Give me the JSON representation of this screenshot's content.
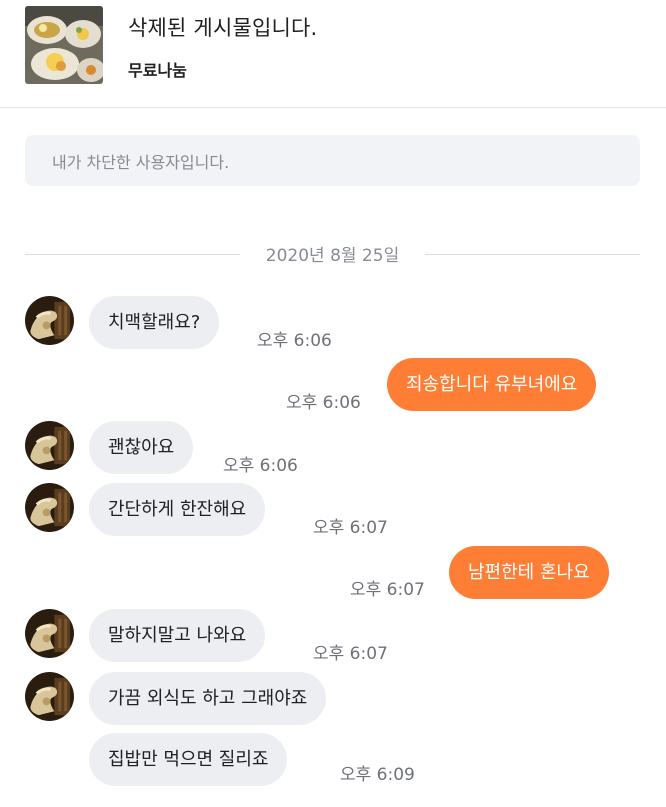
{
  "header": {
    "post_title": "삭제된 게시물입니다.",
    "post_status": "무료나눔"
  },
  "notice": {
    "text": "내가 차단한 사용자입니다."
  },
  "date_divider": "2020년 8월 25일",
  "messages": [
    {
      "text": "치맥할래요?",
      "time": "오후 6:06"
    },
    {
      "text": "죄송합니다 유부녀에요",
      "time": "오후 6:06"
    },
    {
      "text": "괜찮아요",
      "time": "오후 6:06"
    },
    {
      "text": "간단하게 한잔해요",
      "time": "오후 6:07"
    },
    {
      "text": "남편한테 혼나요",
      "time": "오후 6:07"
    },
    {
      "text": "말하지말고 나와요",
      "time": "오후 6:07"
    },
    {
      "text": "가끔 외식도 하고 그래야죠",
      "time": ""
    },
    {
      "text": "집밥만 먹으면 질리죠",
      "time": "오후 6:09"
    }
  ],
  "colors": {
    "outgoing_bubble": "#ff7e36",
    "incoming_bubble": "#eceef2"
  }
}
